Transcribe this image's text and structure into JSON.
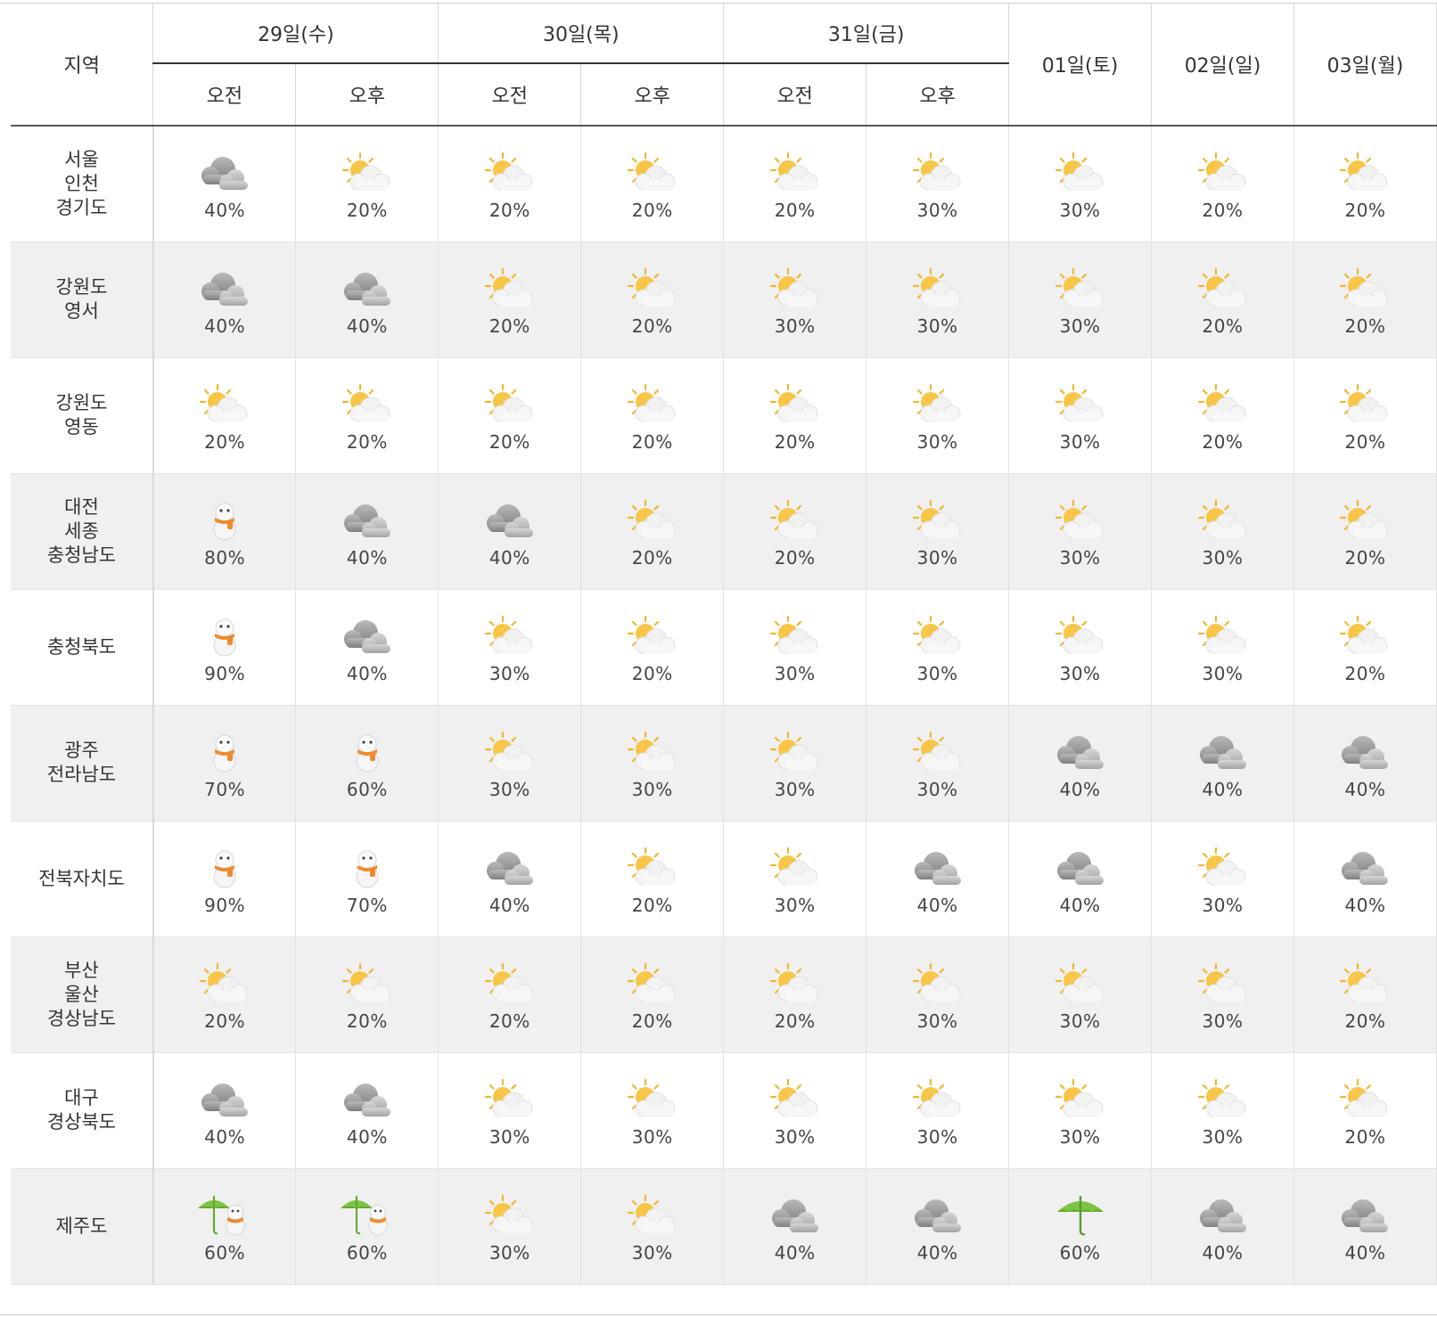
{
  "header": {
    "region_label": "지역",
    "groups": [
      {
        "label": "29일(수)",
        "halves": [
          "오전",
          "오후"
        ]
      },
      {
        "label": "30일(목)",
        "halves": [
          "오전",
          "오후"
        ]
      },
      {
        "label": "31일(금)",
        "halves": [
          "오전",
          "오후"
        ]
      }
    ],
    "single_days": [
      "01일(토)",
      "02일(일)",
      "03일(월)"
    ]
  },
  "icons": {
    "cloudy": "cloudy-icon",
    "partly_cloudy": "partly-cloudy-icon",
    "snow": "snow-icon",
    "rain_snow": "rain-snow-icon",
    "rain": "rain-icon"
  },
  "colors": {
    "sun": "#f5c242",
    "cloud": "#9a9a9a",
    "umbrella": "#7cc443",
    "scarf": "#f08a2e"
  },
  "rows": [
    {
      "region": [
        "서울",
        "인천",
        "경기도"
      ],
      "cells": [
        {
          "icon": "cloudy",
          "pct": "40%"
        },
        {
          "icon": "partly_cloudy",
          "pct": "20%"
        },
        {
          "icon": "partly_cloudy",
          "pct": "20%"
        },
        {
          "icon": "partly_cloudy",
          "pct": "20%"
        },
        {
          "icon": "partly_cloudy",
          "pct": "20%"
        },
        {
          "icon": "partly_cloudy",
          "pct": "30%"
        },
        {
          "icon": "partly_cloudy",
          "pct": "30%"
        },
        {
          "icon": "partly_cloudy",
          "pct": "20%"
        },
        {
          "icon": "partly_cloudy",
          "pct": "20%"
        }
      ]
    },
    {
      "region": [
        "강원도",
        "영서"
      ],
      "cells": [
        {
          "icon": "cloudy",
          "pct": "40%"
        },
        {
          "icon": "cloudy",
          "pct": "40%"
        },
        {
          "icon": "partly_cloudy",
          "pct": "20%"
        },
        {
          "icon": "partly_cloudy",
          "pct": "20%"
        },
        {
          "icon": "partly_cloudy",
          "pct": "30%"
        },
        {
          "icon": "partly_cloudy",
          "pct": "30%"
        },
        {
          "icon": "partly_cloudy",
          "pct": "30%"
        },
        {
          "icon": "partly_cloudy",
          "pct": "20%"
        },
        {
          "icon": "partly_cloudy",
          "pct": "20%"
        }
      ]
    },
    {
      "region": [
        "강원도",
        "영동"
      ],
      "cells": [
        {
          "icon": "partly_cloudy",
          "pct": "20%"
        },
        {
          "icon": "partly_cloudy",
          "pct": "20%"
        },
        {
          "icon": "partly_cloudy",
          "pct": "20%"
        },
        {
          "icon": "partly_cloudy",
          "pct": "20%"
        },
        {
          "icon": "partly_cloudy",
          "pct": "20%"
        },
        {
          "icon": "partly_cloudy",
          "pct": "30%"
        },
        {
          "icon": "partly_cloudy",
          "pct": "30%"
        },
        {
          "icon": "partly_cloudy",
          "pct": "20%"
        },
        {
          "icon": "partly_cloudy",
          "pct": "20%"
        }
      ]
    },
    {
      "region": [
        "대전",
        "세종",
        "충청남도"
      ],
      "cells": [
        {
          "icon": "snow",
          "pct": "80%"
        },
        {
          "icon": "cloudy",
          "pct": "40%"
        },
        {
          "icon": "cloudy",
          "pct": "40%"
        },
        {
          "icon": "partly_cloudy",
          "pct": "20%"
        },
        {
          "icon": "partly_cloudy",
          "pct": "20%"
        },
        {
          "icon": "partly_cloudy",
          "pct": "30%"
        },
        {
          "icon": "partly_cloudy",
          "pct": "30%"
        },
        {
          "icon": "partly_cloudy",
          "pct": "30%"
        },
        {
          "icon": "partly_cloudy",
          "pct": "20%"
        }
      ]
    },
    {
      "region": [
        "충청북도"
      ],
      "cells": [
        {
          "icon": "snow",
          "pct": "90%"
        },
        {
          "icon": "cloudy",
          "pct": "40%"
        },
        {
          "icon": "partly_cloudy",
          "pct": "30%"
        },
        {
          "icon": "partly_cloudy",
          "pct": "20%"
        },
        {
          "icon": "partly_cloudy",
          "pct": "30%"
        },
        {
          "icon": "partly_cloudy",
          "pct": "30%"
        },
        {
          "icon": "partly_cloudy",
          "pct": "30%"
        },
        {
          "icon": "partly_cloudy",
          "pct": "30%"
        },
        {
          "icon": "partly_cloudy",
          "pct": "20%"
        }
      ]
    },
    {
      "region": [
        "광주",
        "전라남도"
      ],
      "cells": [
        {
          "icon": "snow",
          "pct": "70%"
        },
        {
          "icon": "snow",
          "pct": "60%"
        },
        {
          "icon": "partly_cloudy",
          "pct": "30%"
        },
        {
          "icon": "partly_cloudy",
          "pct": "30%"
        },
        {
          "icon": "partly_cloudy",
          "pct": "30%"
        },
        {
          "icon": "partly_cloudy",
          "pct": "30%"
        },
        {
          "icon": "cloudy",
          "pct": "40%"
        },
        {
          "icon": "cloudy",
          "pct": "40%"
        },
        {
          "icon": "cloudy",
          "pct": "40%"
        }
      ]
    },
    {
      "region": [
        "전북자치도"
      ],
      "cells": [
        {
          "icon": "snow",
          "pct": "90%"
        },
        {
          "icon": "snow",
          "pct": "70%"
        },
        {
          "icon": "cloudy",
          "pct": "40%"
        },
        {
          "icon": "partly_cloudy",
          "pct": "20%"
        },
        {
          "icon": "partly_cloudy",
          "pct": "30%"
        },
        {
          "icon": "cloudy",
          "pct": "40%"
        },
        {
          "icon": "cloudy",
          "pct": "40%"
        },
        {
          "icon": "partly_cloudy",
          "pct": "30%"
        },
        {
          "icon": "cloudy",
          "pct": "40%"
        }
      ]
    },
    {
      "region": [
        "부산",
        "울산",
        "경상남도"
      ],
      "cells": [
        {
          "icon": "partly_cloudy",
          "pct": "20%"
        },
        {
          "icon": "partly_cloudy",
          "pct": "20%"
        },
        {
          "icon": "partly_cloudy",
          "pct": "20%"
        },
        {
          "icon": "partly_cloudy",
          "pct": "20%"
        },
        {
          "icon": "partly_cloudy",
          "pct": "20%"
        },
        {
          "icon": "partly_cloudy",
          "pct": "30%"
        },
        {
          "icon": "partly_cloudy",
          "pct": "30%"
        },
        {
          "icon": "partly_cloudy",
          "pct": "30%"
        },
        {
          "icon": "partly_cloudy",
          "pct": "20%"
        }
      ]
    },
    {
      "region": [
        "대구",
        "경상북도"
      ],
      "cells": [
        {
          "icon": "cloudy",
          "pct": "40%"
        },
        {
          "icon": "cloudy",
          "pct": "40%"
        },
        {
          "icon": "partly_cloudy",
          "pct": "30%"
        },
        {
          "icon": "partly_cloudy",
          "pct": "30%"
        },
        {
          "icon": "partly_cloudy",
          "pct": "30%"
        },
        {
          "icon": "partly_cloudy",
          "pct": "30%"
        },
        {
          "icon": "partly_cloudy",
          "pct": "30%"
        },
        {
          "icon": "partly_cloudy",
          "pct": "30%"
        },
        {
          "icon": "partly_cloudy",
          "pct": "20%"
        }
      ]
    },
    {
      "region": [
        "제주도"
      ],
      "cells": [
        {
          "icon": "rain_snow",
          "pct": "60%"
        },
        {
          "icon": "rain_snow",
          "pct": "60%"
        },
        {
          "icon": "partly_cloudy",
          "pct": "30%"
        },
        {
          "icon": "partly_cloudy",
          "pct": "30%"
        },
        {
          "icon": "cloudy",
          "pct": "40%"
        },
        {
          "icon": "cloudy",
          "pct": "40%"
        },
        {
          "icon": "rain",
          "pct": "60%"
        },
        {
          "icon": "cloudy",
          "pct": "40%"
        },
        {
          "icon": "cloudy",
          "pct": "40%"
        }
      ]
    }
  ]
}
